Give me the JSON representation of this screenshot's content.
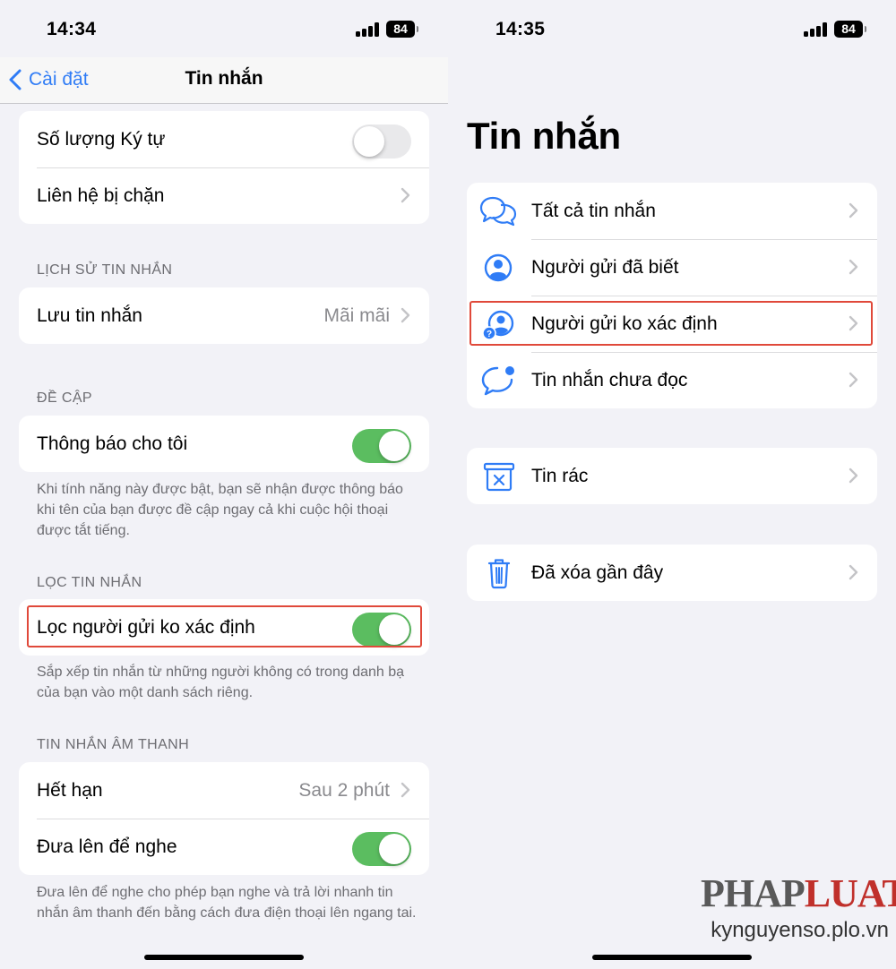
{
  "left": {
    "status": {
      "time": "14:34",
      "battery": "84"
    },
    "navbar": {
      "back_label": "Cài đặt",
      "title": "Tin nhắn"
    },
    "group1": [
      {
        "label": "Số lượng Ký tự",
        "toggle": false
      },
      {
        "label": "Liên hệ bị chặn"
      }
    ],
    "history": {
      "header": "LỊCH SỬ TIN NHẮN",
      "row": {
        "label": "Lưu tin nhắn",
        "value": "Mãi mãi"
      }
    },
    "mentions": {
      "header": "ĐỀ CẬP",
      "row": {
        "label": "Thông báo cho tôi",
        "toggle": true
      },
      "footer": "Khi tính năng này được bật, bạn sẽ nhận được thông báo khi tên của bạn được đề cập ngay cả khi cuộc hội thoại được tắt tiếng."
    },
    "filtering": {
      "header": "LỌC TIN NHẮN",
      "row": {
        "label": "Lọc người gửi ko xác định",
        "toggle": true
      },
      "footer": "Sắp xếp tin nhắn từ những người không có trong danh bạ của bạn vào một danh sách riêng."
    },
    "audio": {
      "header": "TIN NHẮN ÂM THANH",
      "rows": [
        {
          "label": "Hết hạn",
          "value": "Sau 2 phút"
        },
        {
          "label": "Đưa lên để nghe",
          "toggle": true
        }
      ],
      "footer": "Đưa lên để nghe cho phép bạn nghe và trả lời nhanh tin nhắn âm thanh đến bằng cách đưa điện thoại lên ngang tai."
    }
  },
  "right": {
    "status": {
      "time": "14:35",
      "battery": "84"
    },
    "title": "Tin nhắn",
    "filters": [
      {
        "label": "Tất cả tin nhắn",
        "icon": "chat-bubbles-icon"
      },
      {
        "label": "Người gửi đã biết",
        "icon": "person-circle-icon"
      },
      {
        "label": "Người gửi ko xác định",
        "icon": "person-question-icon"
      },
      {
        "label": "Tin nhắn chưa đọc",
        "icon": "unread-bubble-icon"
      }
    ],
    "junk": {
      "label": "Tin rác",
      "icon": "junk-bin-icon"
    },
    "deleted": {
      "label": "Đã xóa gần đây",
      "icon": "trash-icon"
    }
  },
  "watermark": {
    "logo_dark": "PHAP",
    "logo_red": "LUAT",
    "url": "kynguyenso.plo.vn"
  },
  "colors": {
    "accent": "#2f7cf6",
    "toggle_on": "#5bbd60",
    "highlight": "#e0493a"
  }
}
